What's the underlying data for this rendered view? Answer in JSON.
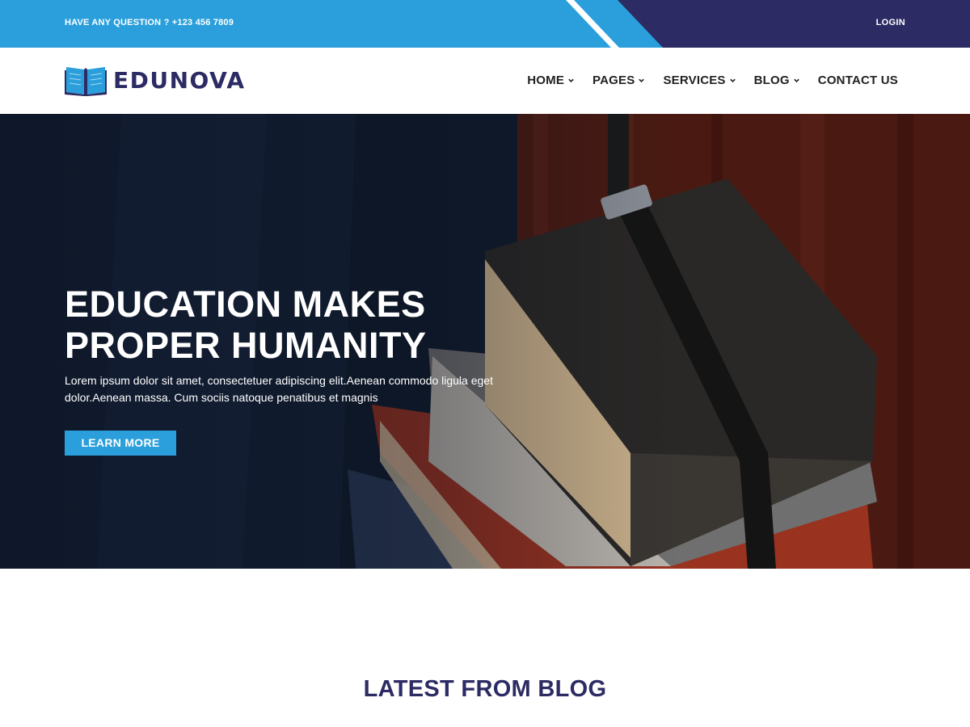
{
  "topbar": {
    "question": "HAVE ANY QUESTION ? +123 456 7809",
    "login": "LOGIN"
  },
  "header": {
    "logo_text": "EDUNOVA",
    "logo_icon": "open-book-icon",
    "nav": [
      {
        "label": "HOME",
        "dropdown": true
      },
      {
        "label": "PAGES",
        "dropdown": true
      },
      {
        "label": "SERVICES",
        "dropdown": true
      },
      {
        "label": "BLOG",
        "dropdown": true
      },
      {
        "label": "CONTACT US",
        "dropdown": false
      }
    ]
  },
  "hero": {
    "title_line1": "EDUCATION MAKES",
    "title_line2": "PROPER HUMANITY",
    "text_line1": "Lorem ipsum dolor sit amet, consectetuer adipiscing elit.Aenean commodo ligula eget",
    "text_line2": "dolor.Aenean massa. Cum sociis natoque penatibus et magnis",
    "button": "LEARN MORE"
  },
  "blog": {
    "title": "LATEST FROM BLOG"
  },
  "colors": {
    "accent_blue": "#2a9fdc",
    "navy": "#2c2b63",
    "nav_text": "#222222"
  }
}
